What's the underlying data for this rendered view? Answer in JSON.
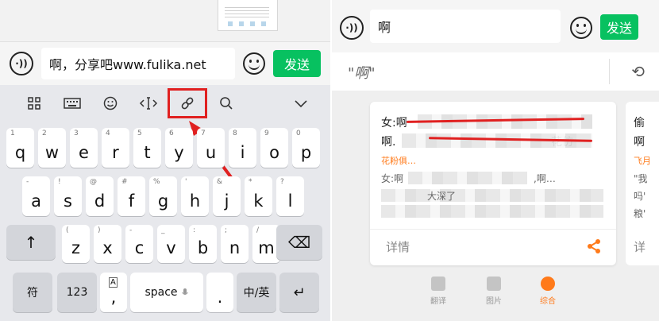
{
  "left": {
    "input": {
      "voice_label": "·))",
      "text": "啊，分享吧www.fulika.net",
      "send_label": "发送"
    },
    "toolbar": {
      "items": [
        "grid-icon",
        "keyboard-icon",
        "emoji-icon",
        "cursor-icon",
        "link-icon",
        "search-icon",
        "chevron-down-icon"
      ]
    },
    "keyboard": {
      "row1": [
        {
          "k": "q",
          "s": "1"
        },
        {
          "k": "w",
          "s": "2"
        },
        {
          "k": "e",
          "s": "3"
        },
        {
          "k": "r",
          "s": "4"
        },
        {
          "k": "t",
          "s": "5"
        },
        {
          "k": "y",
          "s": "6"
        },
        {
          "k": "u",
          "s": "7"
        },
        {
          "k": "i",
          "s": "8"
        },
        {
          "k": "o",
          "s": "9"
        },
        {
          "k": "p",
          "s": "0"
        }
      ],
      "row2": [
        {
          "k": "a",
          "s": "-"
        },
        {
          "k": "s",
          "s": "!"
        },
        {
          "k": "d",
          "s": "@"
        },
        {
          "k": "f",
          "s": "#"
        },
        {
          "k": "g",
          "s": "%"
        },
        {
          "k": "h",
          "s": "'"
        },
        {
          "k": "j",
          "s": "&"
        },
        {
          "k": "k",
          "s": "*"
        },
        {
          "k": "l",
          "s": "?"
        }
      ],
      "row3": [
        {
          "k": "z",
          "s": "("
        },
        {
          "k": "x",
          "s": ")"
        },
        {
          "k": "c",
          "s": "-"
        },
        {
          "k": "v",
          "s": "_"
        },
        {
          "k": "b",
          "s": ":"
        },
        {
          "k": "n",
          "s": ";"
        },
        {
          "k": "m",
          "s": "/"
        }
      ],
      "shift_label": "↑",
      "backspace_label": "⌫",
      "symbol_label": "符",
      "num_label": "123",
      "comma_label": ",",
      "space_label": "space",
      "period_label": ".",
      "lang_label": "中/英",
      "enter_label": "↵"
    }
  },
  "right": {
    "input": {
      "voice_label": "·))",
      "text": "啊",
      "send_label": "发送"
    },
    "query": "\"啊\"",
    "back_label": "⟲",
    "card": {
      "line1": "女:啊",
      "line2": "啊.",
      "line2b": "花仿",
      "source": "花粉俱…",
      "line3": "女:啊",
      "line3b": ",啊…",
      "line4": "大深了",
      "detail_label": "详情"
    },
    "card2": {
      "line1": "偷",
      "line2": "啊",
      "source": "飞月",
      "line3": "\"我",
      "line4": "吗'",
      "line5": "粮'",
      "detail": "详"
    },
    "tabs": [
      {
        "label": "翻译",
        "color": "#bdbdbd"
      },
      {
        "label": "图片",
        "color": "#bdbdbd"
      },
      {
        "label": "综合",
        "color": "#ff7a1a"
      }
    ],
    "colors": {
      "send": "#07c160",
      "accent": "#ff7a1a",
      "highlight": "#e02020"
    }
  }
}
